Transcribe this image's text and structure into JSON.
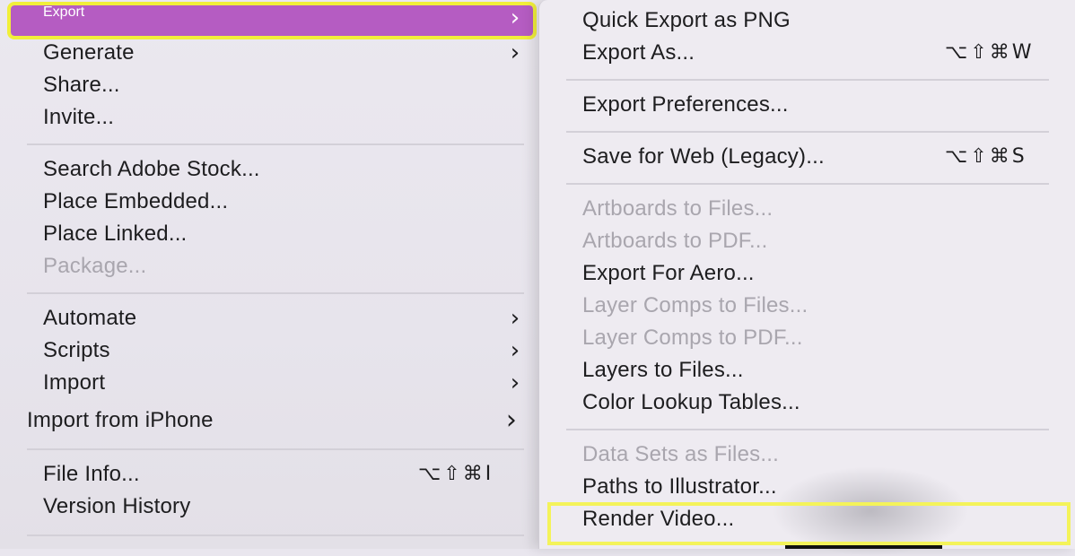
{
  "main_menu": {
    "items": [
      {
        "label": "Export",
        "has_submenu": true,
        "selected": true
      },
      {
        "label": "Generate",
        "has_submenu": true
      },
      {
        "label": "Share..."
      },
      {
        "label": "Invite..."
      },
      {
        "label": "Search Adobe Stock..."
      },
      {
        "label": "Place Embedded..."
      },
      {
        "label": "Place Linked..."
      },
      {
        "label": "Package...",
        "disabled": true
      },
      {
        "label": "Automate",
        "has_submenu": true
      },
      {
        "label": "Scripts",
        "has_submenu": true
      },
      {
        "label": "Import",
        "has_submenu": true
      },
      {
        "label": "Import from iPhone",
        "has_submenu": true
      },
      {
        "label": "File Info...",
        "shortcut": "⌥⇧⌘I"
      },
      {
        "label": "Version History"
      }
    ]
  },
  "export_submenu": {
    "items": [
      {
        "label": "Quick Export as PNG"
      },
      {
        "label": "Export As...",
        "shortcut": "⌥⇧⌘W"
      },
      {
        "label": "Export Preferences..."
      },
      {
        "label": "Save for Web (Legacy)...",
        "shortcut": "⌥⇧⌘S"
      },
      {
        "label": "Artboards to Files...",
        "disabled": true
      },
      {
        "label": "Artboards to PDF...",
        "disabled": true
      },
      {
        "label": "Export For Aero..."
      },
      {
        "label": "Layer Comps to Files...",
        "disabled": true
      },
      {
        "label": "Layer Comps to PDF...",
        "disabled": true
      },
      {
        "label": "Layers to Files..."
      },
      {
        "label": "Color Lookup Tables..."
      },
      {
        "label": "Data Sets as Files...",
        "disabled": true
      },
      {
        "label": "Paths to Illustrator..."
      },
      {
        "label": "Render Video...",
        "highlighted": true
      }
    ]
  },
  "glyphs": {
    "chevron": "›"
  },
  "colors": {
    "selection": "#b55cc2",
    "highlight_outline": "#f1ef3a",
    "disabled_text": "#a9a6ae",
    "text": "#1d1d1f"
  }
}
